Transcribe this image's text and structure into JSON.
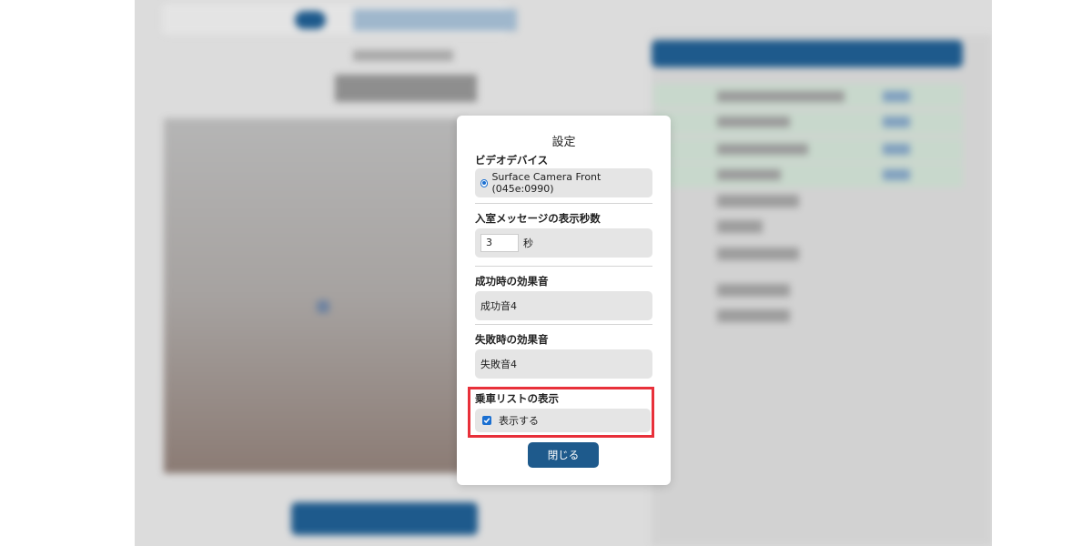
{
  "dialog": {
    "title": "設定",
    "video_device": {
      "label": "ビデオデバイス",
      "selected_option": "Surface Camera Front (045e:0990)"
    },
    "entry_message": {
      "label": "入室メッセージの表示秒数",
      "value": "3",
      "unit": "秒"
    },
    "success_sound": {
      "label": "成功時の効果音",
      "value": "成功音4"
    },
    "failure_sound": {
      "label": "失敗時の効果音",
      "value": "失敗音4"
    },
    "boarding_list": {
      "label": "乗車リストの表示",
      "checkbox_label": "表示する",
      "checked": true
    },
    "close_button_label": "閉じる"
  },
  "colors": {
    "accent": "#1e5a8c",
    "highlight": "#e8303a",
    "control_blue": "#1a6fd1"
  },
  "icons": {
    "radio": "radio-selected-icon",
    "checkbox": "checkbox-checked-icon"
  }
}
